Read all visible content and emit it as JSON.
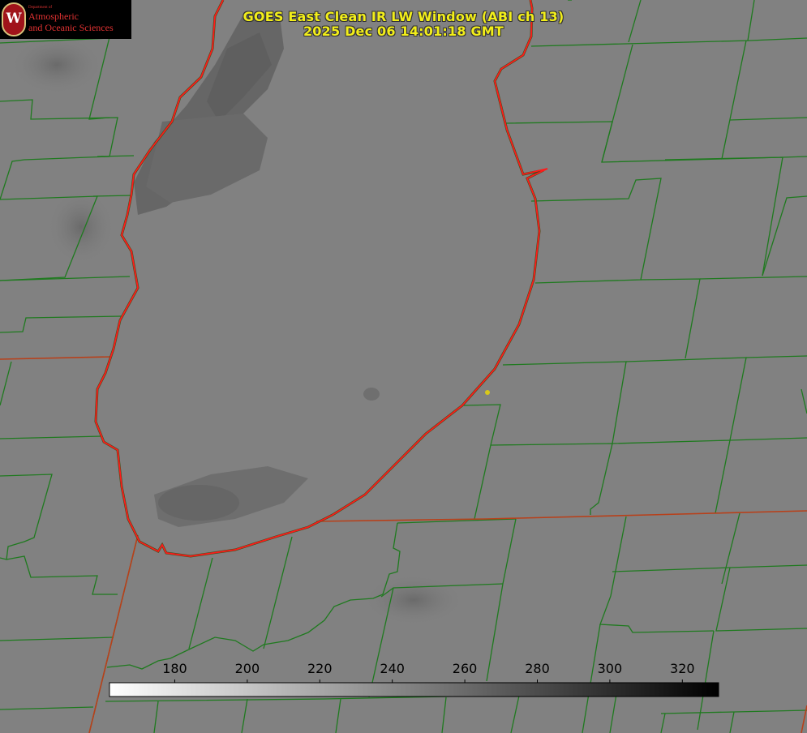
{
  "title": "GOES East Clean IR LW Window (ABI ch 13)",
  "timestamp": "2025 Dec 06 14:01:18 GMT",
  "logo": {
    "dept": "Department of",
    "line1": "Atmospheric",
    "line2": "and Oceanic Sciences",
    "seal_letter": "W"
  },
  "colorbar": {
    "ticks": [
      "180",
      "200",
      "220",
      "240",
      "260",
      "280",
      "300",
      "320"
    ],
    "min": 162,
    "max": 330,
    "gradient": [
      "#ffffff",
      "#000000"
    ]
  },
  "colors": {
    "title": "#f2ee1a",
    "county_lines": "#1f7a1f",
    "coastline": "#ff1a1a",
    "state_line": "#b8401a",
    "marker": "#d8c81a"
  }
}
